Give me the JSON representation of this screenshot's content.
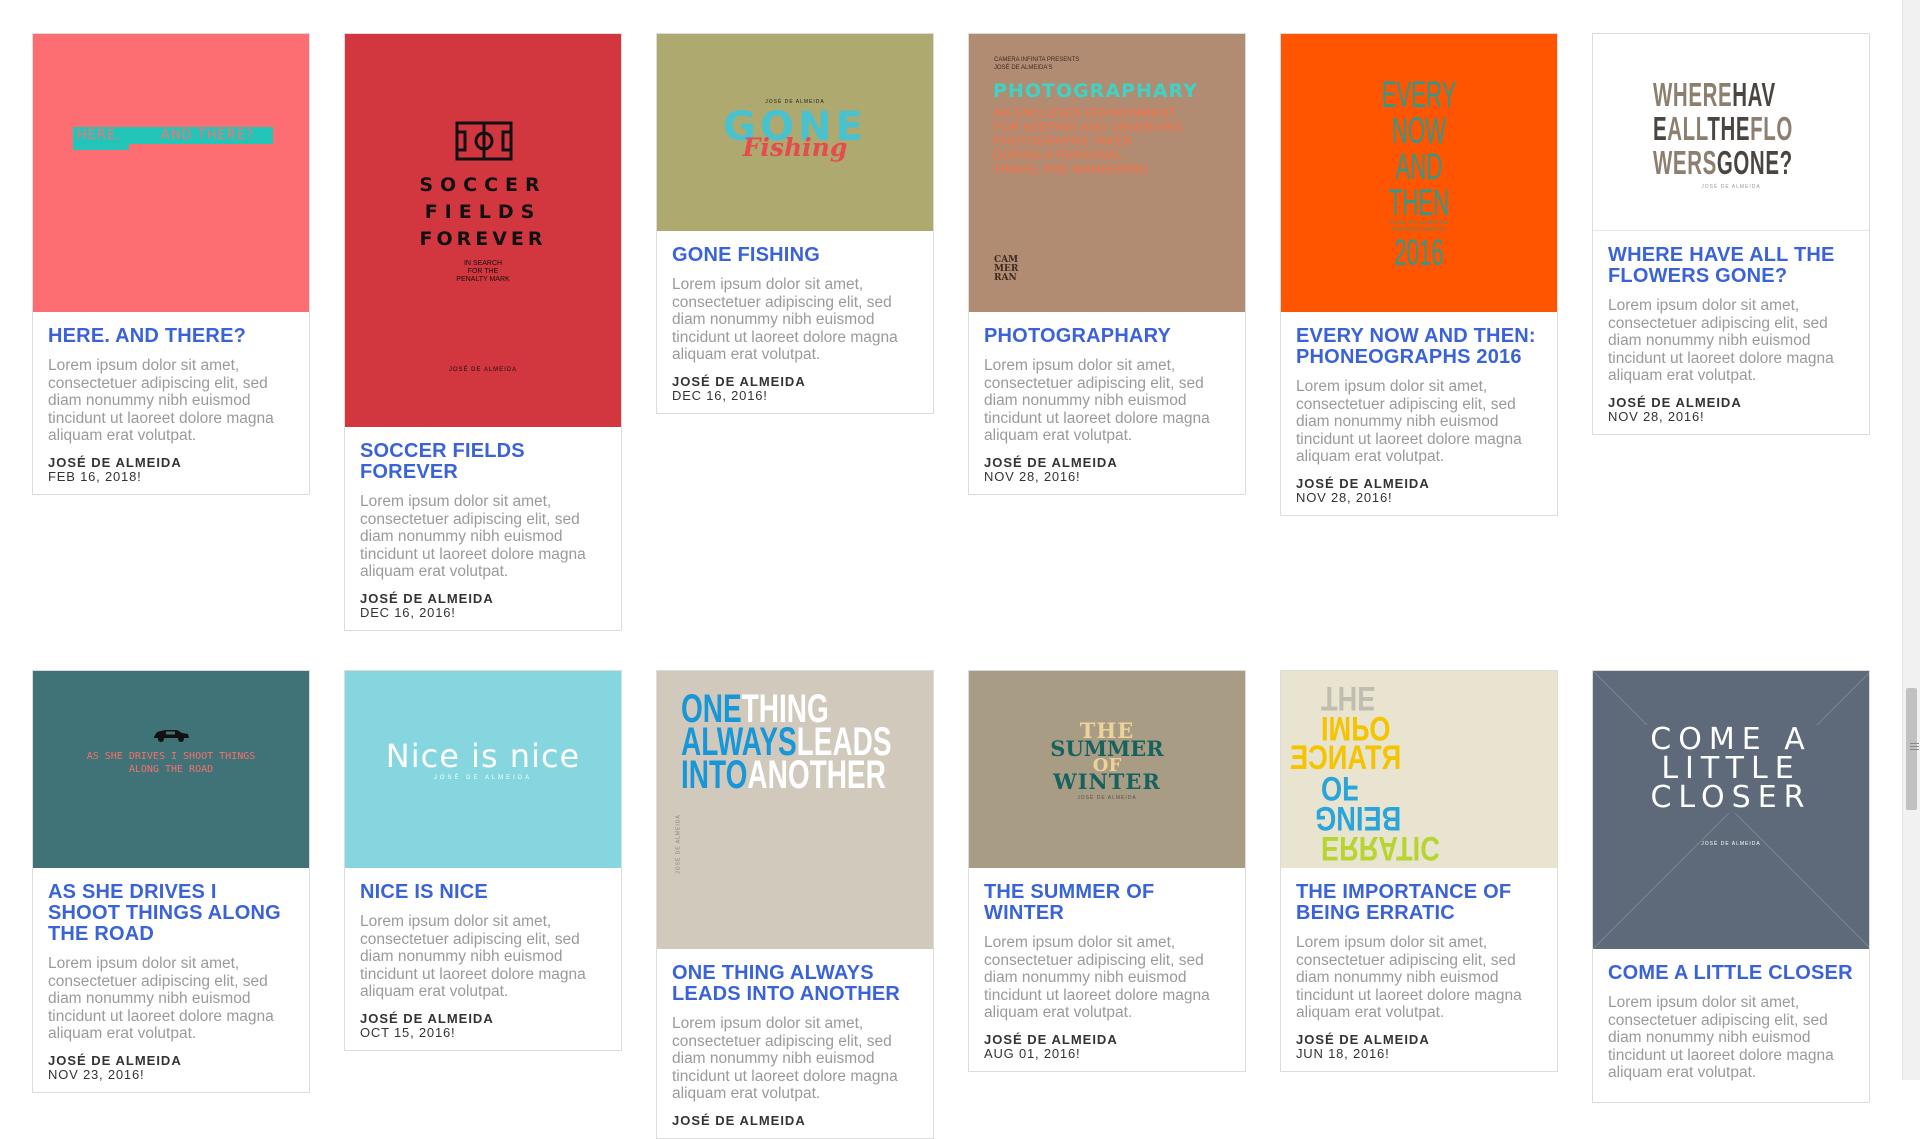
{
  "lorem": "Lorem ipsum dolor sit amet, consectetuer adipiscing elit, sed diam nonummy nibh euismod tincidunt ut laoreet dolore magna aliquam erat volutpat.",
  "posts": [
    {
      "title": "HERE. AND THERE?",
      "author": "JOSÉ DE ALMEIDA",
      "date": "FEB 16, 2018!",
      "cover_color": "#fc6e72",
      "cover": {
        "left": "HERE.",
        "right": "AND THERE?"
      }
    },
    {
      "title": "SOCCER FIELDS FOREVER",
      "author": "JOSÉ DE ALMEIDA",
      "date": "DEC 16, 2016!",
      "cover_color": "#d2373f",
      "cover": {
        "line1": "SOCCER",
        "line2": "FIELDS",
        "line3": "FOREVER",
        "sub1": "IN SEARCH",
        "sub2": "FOR THE",
        "sub3": "PENALTY MARK",
        "foot": "JOSÉ DE ALMEIDA"
      }
    },
    {
      "title": "GONE FISHING",
      "author": "JOSÉ DE ALMEIDA",
      "date": "DEC 16, 2016!",
      "cover_color": "#ada96f",
      "cover": {
        "top": "JOSÉ DE ALMEIDA",
        "big": "GONE",
        "script": "Fishing"
      }
    },
    {
      "title": "PHOTOGRAPHARY",
      "author": "JOSÉ DE ALMEIDA",
      "date": "NOV 28, 2016!",
      "cover_color": "#b28b73",
      "cover": {
        "pre1": "CAMERA INFINITA PRESENTS",
        "pre2": "JOSÉ DE ALMEIDA'S",
        "head": "PHOTOGRAPHARY",
        "l1": "AN ENCLOSED ENVIRONMENT",
        "l2": "FOR KEEPING AND OBSERVING",
        "l3": "PHOTOGRAPHS TAKEN",
        "l4": "DURING A PERSONAL",
        "l5": "TRAVEL AND WANDERING",
        "logo1": "CAM",
        "logo2": "MER",
        "logo3": "RAN"
      }
    },
    {
      "title": "EVERY NOW AND THEN: PHONEOGRAPHS 2016",
      "author": "JOSÉ DE ALMEIDA",
      "date": "NOV 28, 2016!",
      "cover_color": "#ff5400",
      "cover": {
        "w1": "EVERY",
        "w2": "NOW",
        "w3": "AND",
        "w4": "THEN",
        "w5": "2016",
        "sub": "JOSÉ DE ALMEIDA",
        "sub2": "PHONEOGRAPHS"
      }
    },
    {
      "title": "WHERE HAVE ALL THE FLOWERS GONE?",
      "author": "JOSÉ DE ALMEIDA",
      "date": "NOV 28, 2016!",
      "cover_color": "#ffffff",
      "cover": {
        "r1a": "WHERE",
        "r1b": "HAV",
        "r2a": "E",
        "r2b": "ALL",
        "r2c": "THE",
        "r2d": "FLO",
        "r3a": "WERS",
        "r3b": "GONE?",
        "sub": "JOSÉ DE ALMEIDA"
      }
    },
    {
      "title": "AS SHE DRIVES I SHOOT THINGS ALONG THE ROAD",
      "author": "JOSÉ DE ALMEIDA",
      "date": "NOV 23, 2016!",
      "cover_color": "#3f7377",
      "cover": {
        "l1": "AS SHE DRIVES I SHOOT THINGS",
        "l2": "ALONG THE ROAD"
      }
    },
    {
      "title": "NICE IS NICE",
      "author": "JOSÉ DE ALMEIDA",
      "date": "OCT 15, 2016!",
      "cover_color": "#85d6df",
      "cover": {
        "big": "Nice is nice",
        "sub": "JOSÉ DE ALMEIDA"
      }
    },
    {
      "title": "ONE THING ALWAYS LEADS INTO ANOTHER",
      "author": "JOSÉ DE ALMEIDA",
      "date": "",
      "cover_color": "#d2c9bd",
      "cover": {
        "a1": "ONE",
        "b1": "THING",
        "a2": "ALWAYS",
        "b2": "LEADS",
        "a3": "INTO",
        "b3": "ANOTHER",
        "side": "JOSÉ DE ALMEIDA"
      }
    },
    {
      "title": "THE SUMMER OF WINTER",
      "author": "JOSÉ DE ALMEIDA",
      "date": "AUG 01, 2016!",
      "cover_color": "#a99c85",
      "cover": {
        "l1": "THE",
        "l2": "SUMMER",
        "l3": "OF",
        "l4": "WINTER",
        "sub": "JOSÉ DE ALMEIDA"
      }
    },
    {
      "title": "THE IMPORTANCE OF BEING ERRATIC",
      "author": "JOSÉ DE ALMEIDA",
      "date": "JUN 18, 2016!",
      "cover_color": "#e8e4cf",
      "cover": {
        "l1": "THE",
        "l2": "IMPO",
        "l3": "RTANCE",
        "l4": "OF",
        "l5": "BEING",
        "l6": "ERRATIC"
      }
    },
    {
      "title": "COME A LITTLE CLOSER",
      "author": "",
      "date": "",
      "cover_color": "#5e6a79",
      "cover": {
        "l1": "COME A",
        "l2": "LITTLE",
        "l3": "CLOSER",
        "sub": "JOSÉ DE ALMEIDA"
      }
    }
  ]
}
